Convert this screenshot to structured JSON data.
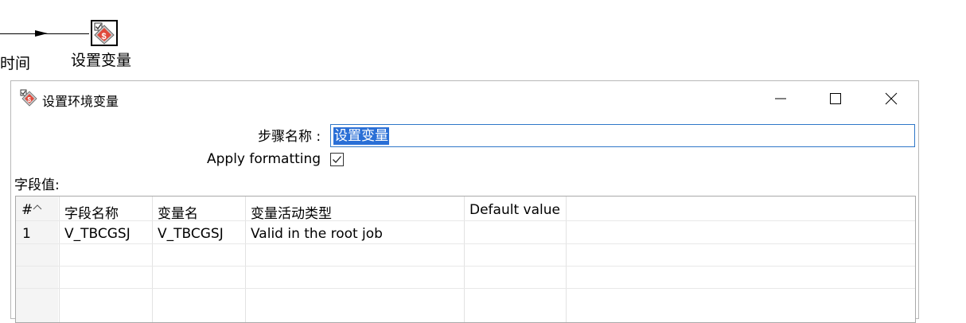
{
  "canvas": {
    "previous_step_label": "时间",
    "step_label": "设置变量"
  },
  "dialog": {
    "title": "设置环境变量",
    "window_buttons": {
      "minimize": "minimize-icon",
      "maximize": "maximize-icon",
      "close": "close-icon"
    },
    "step_name_label": "步骤名称 :",
    "step_name_value": "设置变量",
    "apply_formatting_label": "Apply formatting",
    "apply_formatting_checked": true,
    "fields_label": "字段值:",
    "table": {
      "columns": [
        "#",
        "字段名称",
        "变量名",
        "变量活动类型",
        "Default value"
      ],
      "rows": [
        [
          "1",
          "V_TBCGSJ",
          "V_TBCGSJ",
          "Valid in the root job",
          ""
        ]
      ]
    }
  },
  "colors": {
    "selection": "#2a6fd6",
    "input_border": "#2f77c8"
  }
}
